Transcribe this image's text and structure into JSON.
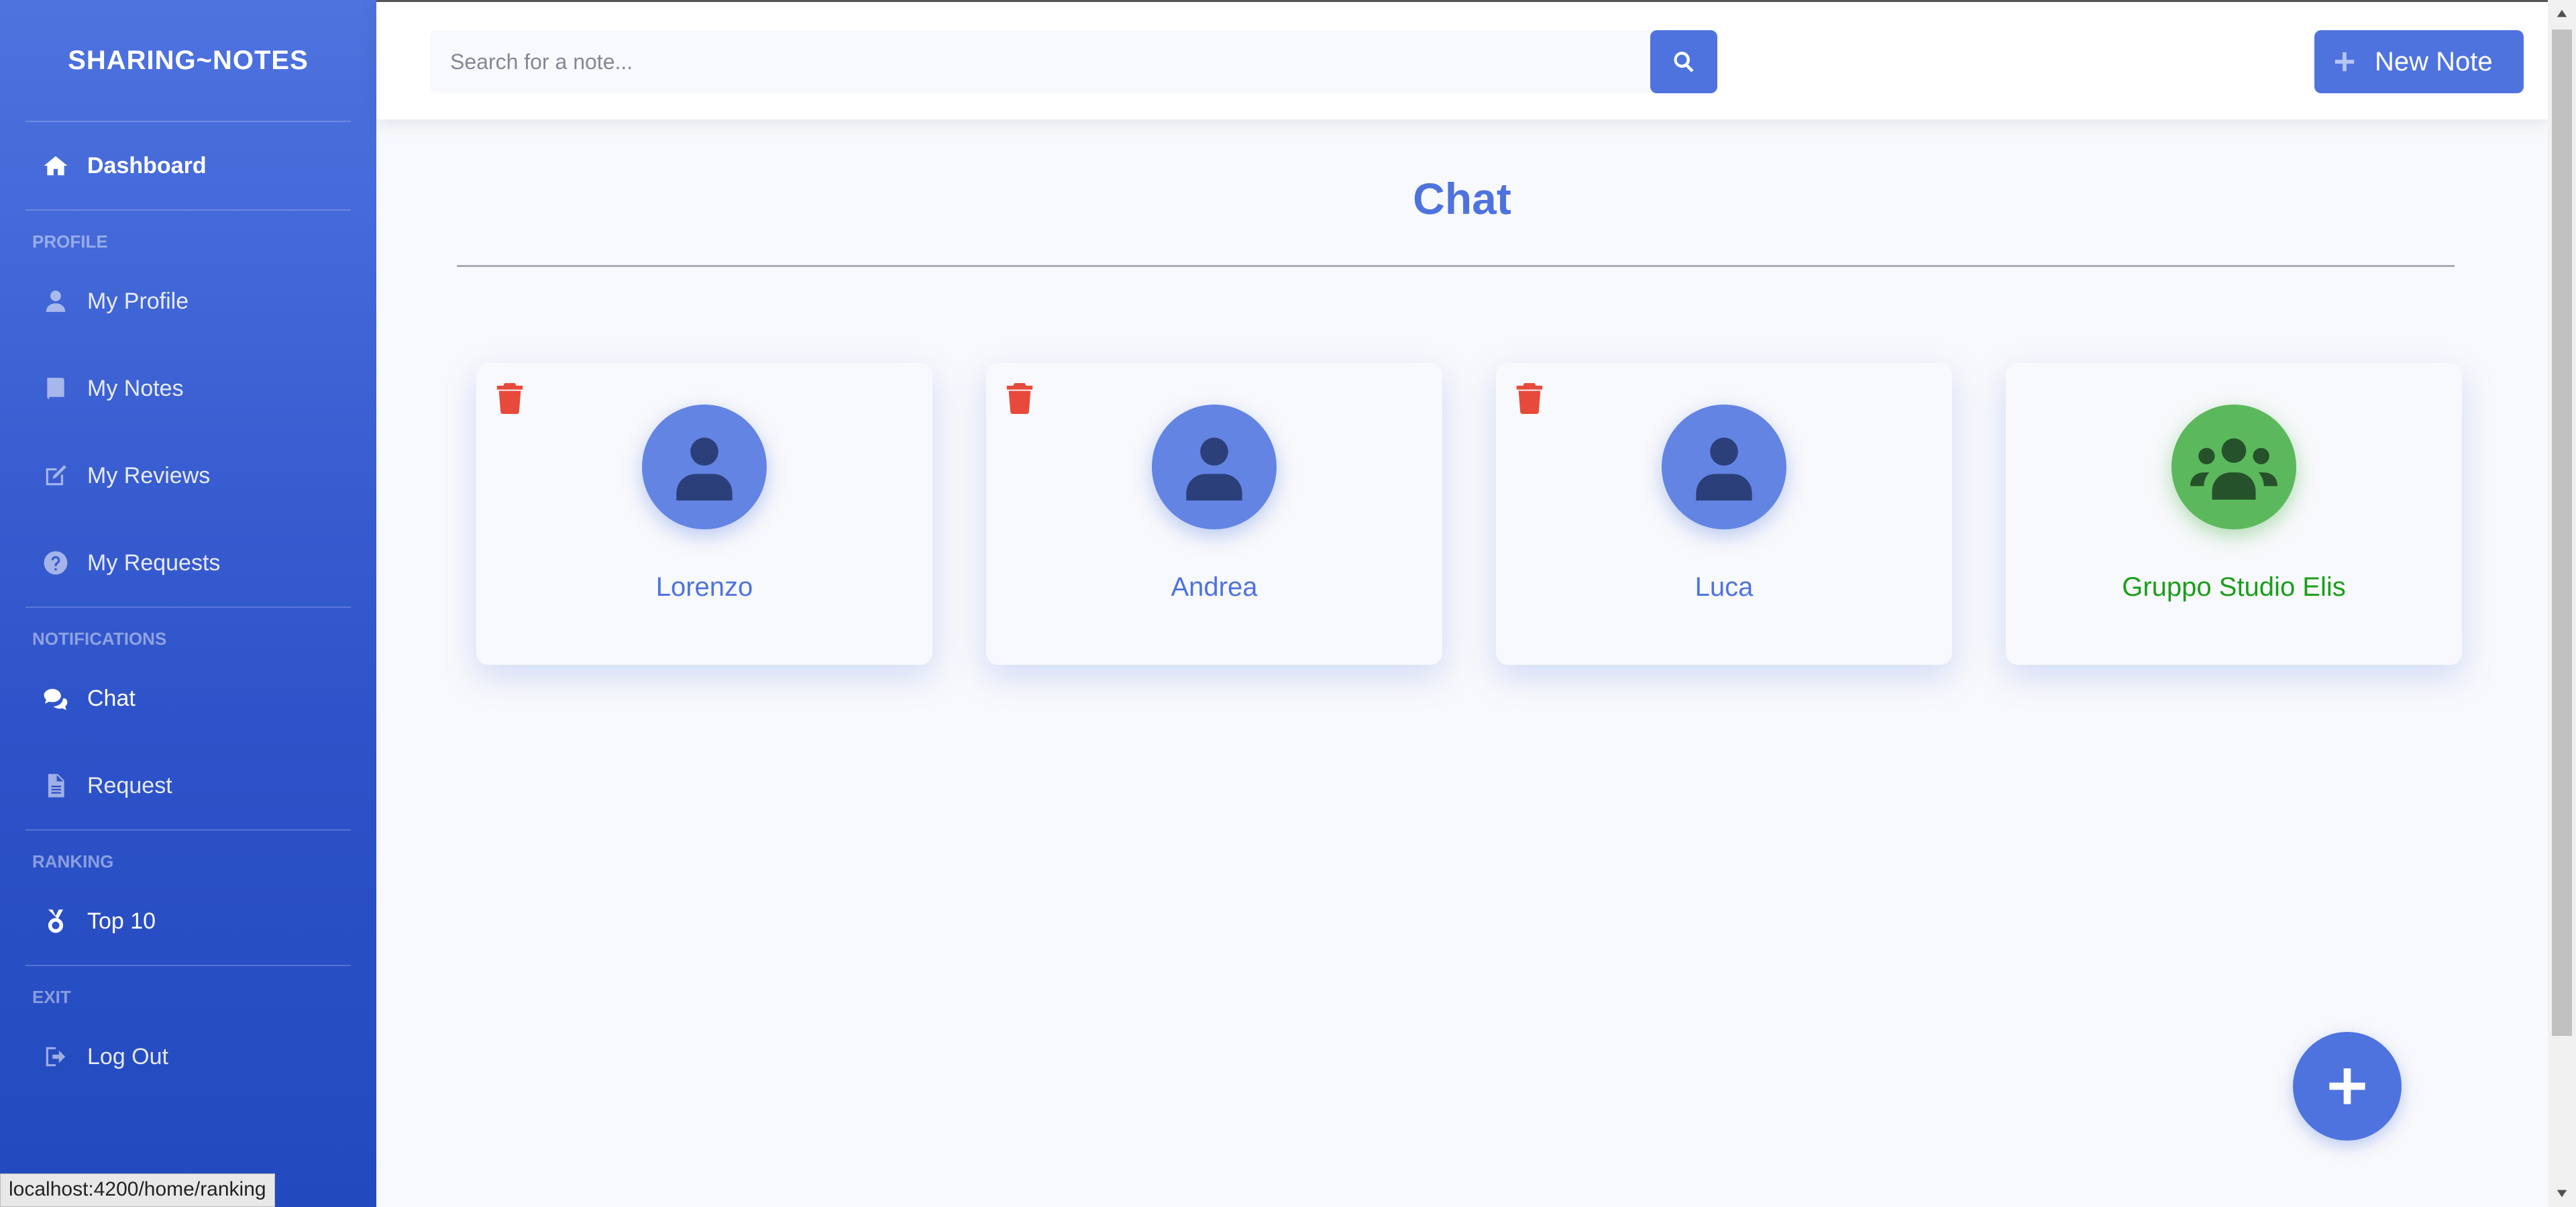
{
  "sidebar": {
    "brand": "SHARING~NOTES",
    "dashboard": "Dashboard",
    "sections": {
      "profile": "PROFILE",
      "notifications": "NOTIFICATIONS",
      "ranking": "RANKING",
      "exit": "EXIT"
    },
    "items": {
      "my_profile": "My Profile",
      "my_notes": "My Notes",
      "my_reviews": "My Reviews",
      "my_requests": "My Requests",
      "chat": "Chat",
      "request": "Request",
      "top10": "Top 10",
      "logout": "Log Out"
    }
  },
  "topbar": {
    "search_placeholder": "Search for a note...",
    "new_note_label": "New Note"
  },
  "main": {
    "title": "Chat",
    "chats": [
      {
        "name": "Lorenzo",
        "type": "user"
      },
      {
        "name": "Andrea",
        "type": "user"
      },
      {
        "name": "Luca",
        "type": "user"
      },
      {
        "name": "Gruppo Studio Elis",
        "type": "group"
      }
    ]
  },
  "status_bar": {
    "url": "localhost:4200/home/ranking"
  },
  "colors": {
    "primary": "#4e73df",
    "danger": "#e74a3b",
    "group": "#5cb85c"
  }
}
